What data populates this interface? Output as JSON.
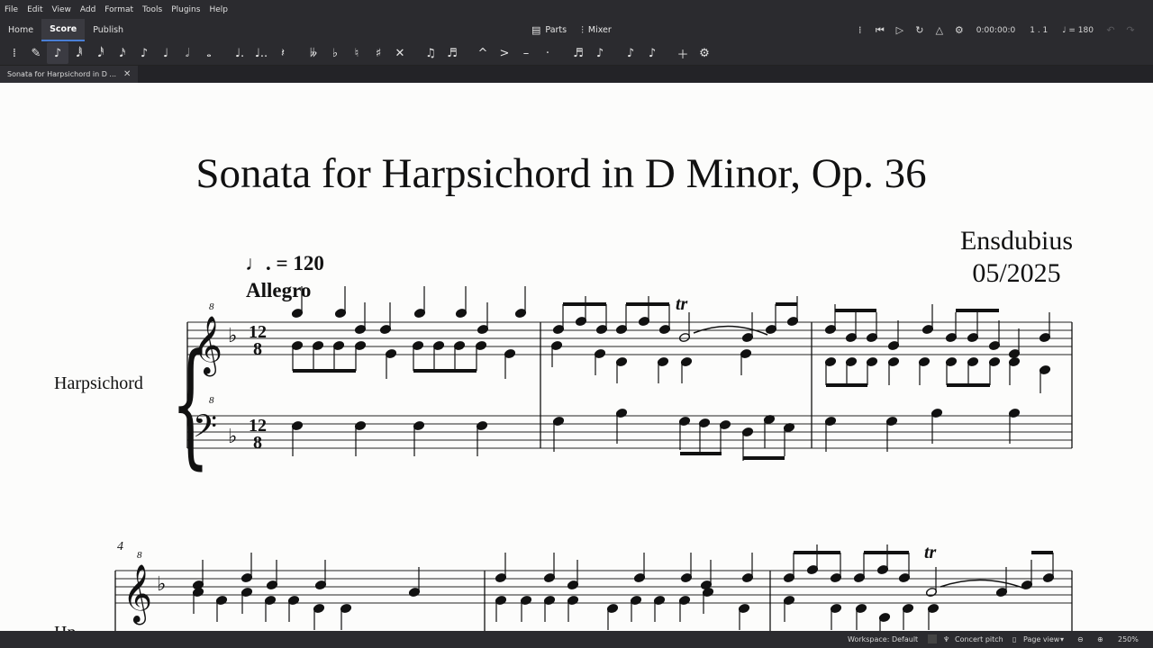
{
  "menu": [
    "File",
    "Edit",
    "View",
    "Add",
    "Format",
    "Tools",
    "Plugins",
    "Help"
  ],
  "tabs": [
    "Home",
    "Score",
    "Publish"
  ],
  "top_buttons": {
    "parts": "Parts",
    "mixer": "Mixer"
  },
  "playback": {
    "time": "0:00:00:0",
    "position": "1 . 1",
    "tempo": "= 180"
  },
  "document_tab": "Sonata for Harpsichord in D ...",
  "score": {
    "title": "Sonata for Harpsichord in D Minor, Op. 36",
    "composer": "Ensdubius",
    "date": "05/2025",
    "tempo_marking": "= 120",
    "tempo_text": "Allegro",
    "instrument": "Harpsichord",
    "instrument_short": "Hp",
    "measure_number": "4",
    "time_signature_top": "12",
    "time_signature_bottom": "8",
    "ottava": "8",
    "trill": "tr"
  },
  "status": {
    "workspace": "Workspace: Default",
    "concert_pitch": "Concert pitch",
    "view": "Page view",
    "zoom": "250%"
  },
  "icons": [
    "pen-icon",
    "note-input-icon",
    "parts-icon",
    "mixer-icon",
    "play-icon",
    "rewind-icon",
    "loop-icon",
    "metronome-icon",
    "settings-icon",
    "undo-icon",
    "redo-icon",
    "zoom-out-icon",
    "zoom-in-icon"
  ]
}
